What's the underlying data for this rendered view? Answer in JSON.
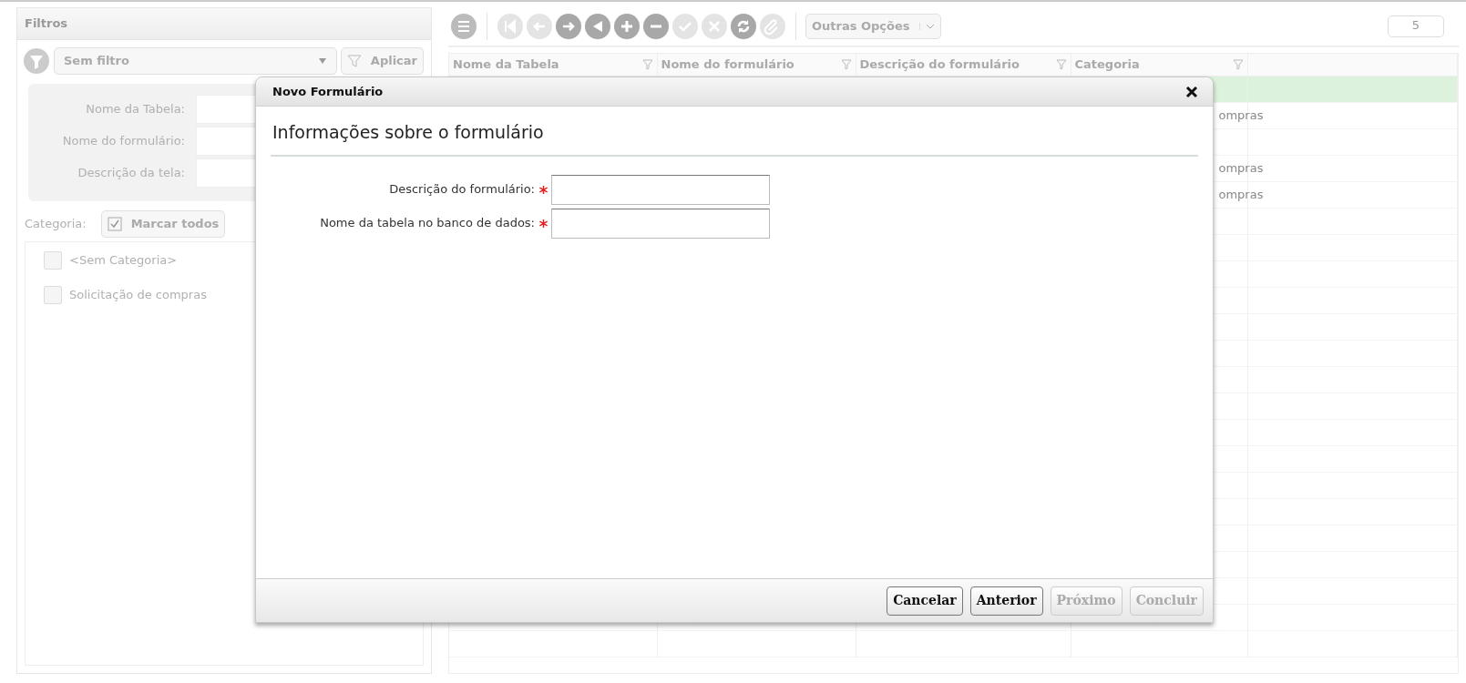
{
  "filters": {
    "title": "Filtros",
    "filter_select": {
      "value": "Sem filtro"
    },
    "apply_button": "Aplicar",
    "fields": [
      {
        "label": "Nome da Tabela:"
      },
      {
        "label": "Nome do formulário:"
      },
      {
        "label": "Descrição da tela:"
      }
    ],
    "category_label": "Categoria:",
    "check_all_button": "Marcar todos",
    "categories": [
      {
        "label": "<Sem Categoria>",
        "checked": false
      },
      {
        "label": "Solicitação de compras",
        "checked": false
      }
    ]
  },
  "toolbar": {
    "buttons": [
      {
        "kind": "first",
        "disabled": true
      },
      {
        "kind": "prev",
        "disabled": true
      },
      {
        "kind": "next",
        "disabled": false
      },
      {
        "kind": "back",
        "disabled": false
      },
      {
        "kind": "add",
        "disabled": false
      },
      {
        "kind": "remove",
        "disabled": false
      },
      {
        "kind": "confirm",
        "disabled": true
      },
      {
        "kind": "cancel",
        "disabled": true
      },
      {
        "kind": "refresh",
        "disabled": false
      },
      {
        "kind": "link",
        "disabled": true
      }
    ],
    "options_button": "Outras Opções",
    "page_count": "5"
  },
  "grid": {
    "columns": [
      "Nome da Tabela",
      "Nome do formulário",
      "Descrição do formulário",
      "Categoria"
    ],
    "rows": [
      {
        "selected": true
      },
      {
        "selected": false,
        "category": "ompras"
      },
      {
        "selected": false
      },
      {
        "selected": false,
        "category": "ompras"
      },
      {
        "selected": false,
        "category": "ompras"
      }
    ]
  },
  "dialog": {
    "title": "Novo Formulário",
    "section_title": "Informações sobre o formulário",
    "fields": [
      {
        "label": "Descrição do formulário:",
        "required": true
      },
      {
        "label": "Nome da tabela no banco de dados:",
        "required": true
      }
    ],
    "buttons": [
      {
        "label": "Cancelar",
        "disabled": false
      },
      {
        "label": "Anterior",
        "disabled": false
      },
      {
        "label": "Próximo",
        "disabled": true
      },
      {
        "label": "Concluir",
        "disabled": true
      }
    ]
  }
}
